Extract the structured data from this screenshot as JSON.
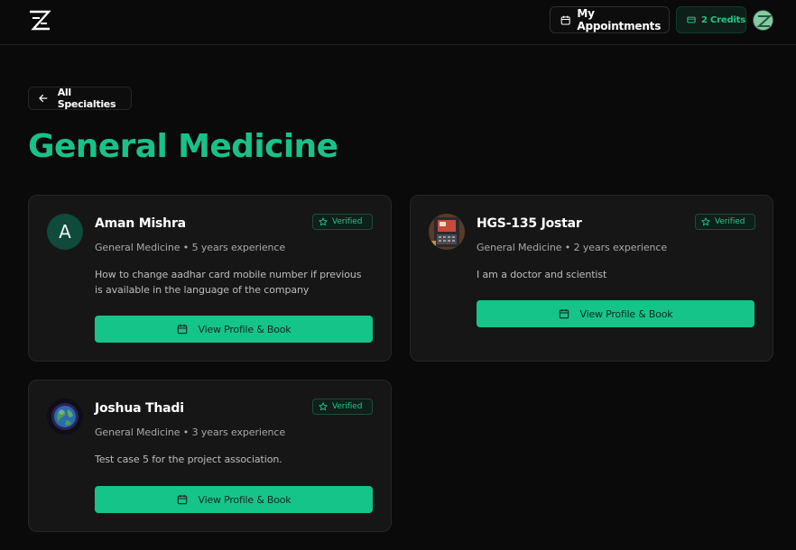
{
  "header": {
    "appointments_label": "My Appointments",
    "credits_label": "2 Credits",
    "accent_color": "#19c189"
  },
  "nav": {
    "back_label": "All Specialties"
  },
  "page": {
    "title": "General Medicine"
  },
  "doctors": [
    {
      "initial": "A",
      "name": "Aman Mishra",
      "meta": "General Medicine • 5 years experience",
      "description": "How to change aadhar card mobile number if previous is available in the language of the company",
      "badge": "Verified",
      "button_label": "View Profile & Book"
    },
    {
      "name": "HGS-135 Jostar",
      "meta": "General Medicine • 2 years experience",
      "description": "I am a doctor and scientist",
      "badge": "Verified",
      "button_label": "View Profile & Book"
    },
    {
      "name": "Joshua Thadi",
      "meta": "General Medicine • 3 years experience",
      "description": "Test case 5 for the project association.",
      "badge": "Verified",
      "button_label": "View Profile & Book"
    }
  ]
}
